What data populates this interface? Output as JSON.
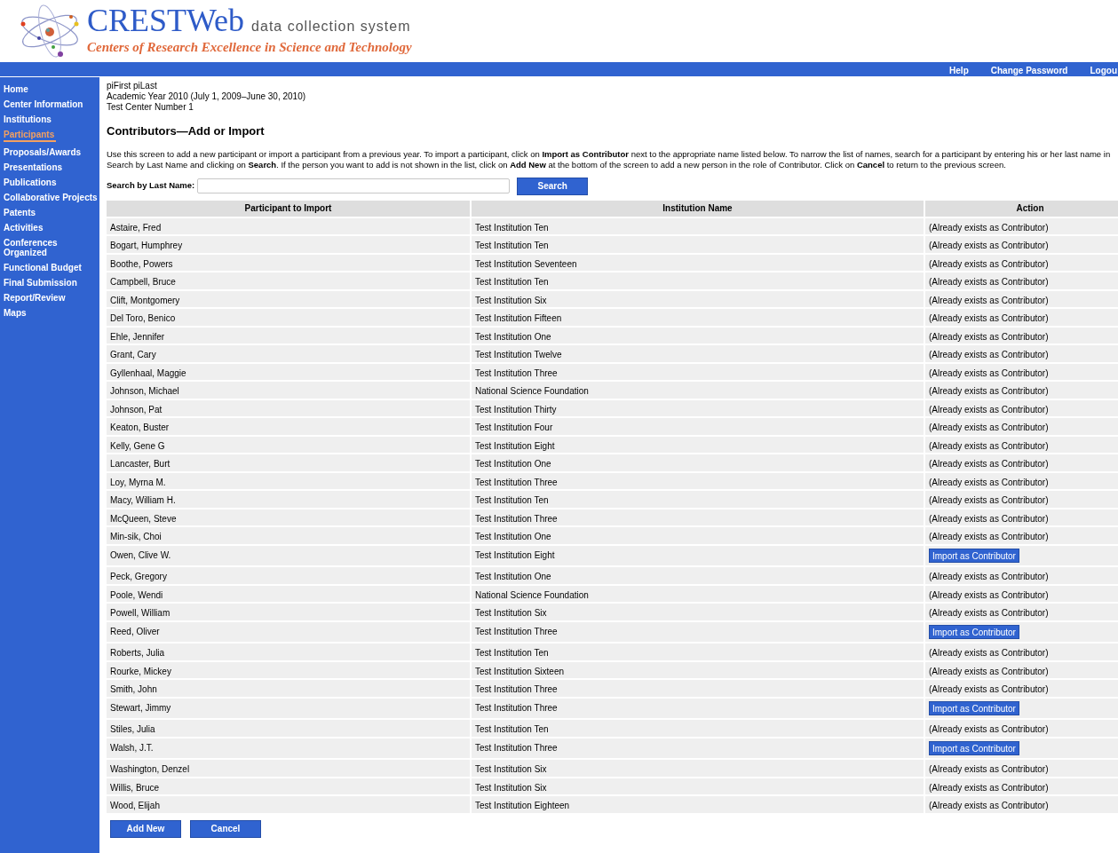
{
  "header": {
    "logo_title": "CRESTWeb",
    "logo_tagline": "data collection system",
    "logo_subtitle": "Centers of Research Excellence in Science and Technology"
  },
  "top_links": [
    "Help",
    "Change Password",
    "Logou"
  ],
  "sidebar": {
    "items": [
      {
        "label": "Home",
        "selected": false
      },
      {
        "label": "Center Information",
        "selected": false
      },
      {
        "label": "Institutions",
        "selected": false
      },
      {
        "label": "Participants",
        "selected": true
      },
      {
        "label": "Proposals/Awards",
        "selected": false
      },
      {
        "label": "Presentations",
        "selected": false
      },
      {
        "label": "Publications",
        "selected": false
      },
      {
        "label": "Collaborative Projects",
        "selected": false
      },
      {
        "label": "Patents",
        "selected": false
      },
      {
        "label": "Activities",
        "selected": false
      },
      {
        "label": "Conferences Organized",
        "selected": false
      },
      {
        "label": "Functional Budget",
        "selected": false
      },
      {
        "label": "Final Submission",
        "selected": false
      },
      {
        "label": "Report/Review",
        "selected": false
      },
      {
        "label": "Maps",
        "selected": false
      }
    ]
  },
  "context": [
    "piFirst piLast",
    "Academic Year 2010 (July 1, 2009–June 30, 2010)",
    "Test Center Number 1"
  ],
  "page_title": "Contributors—Add or Import",
  "intro": [
    "Use this screen to add a new participant or import a participant from a previous year. To import a participant, click on **Import as Contributor** next to the appropriate name listed below. To narrow the list of names, search for a participant by entering his or her last name in",
    "Search by Last Name and clicking on **Search**. If the person you want to add is not shown in the list, click on **Add New** at the bottom of the screen to add a new person in the role of Contributor. Click on **Cancel** to return to the previous screen."
  ],
  "search": {
    "label": "Search by Last Name:",
    "button": "Search"
  },
  "table": {
    "columns": [
      "Participant to Import",
      "Institution Name",
      "Action"
    ],
    "rows": [
      {
        "name": "Astaire, Fred",
        "institution": "Test Institution Ten",
        "kind": "exists",
        "action": "(Already exists as Contributor)"
      },
      {
        "name": "Bogart, Humphrey",
        "institution": "Test Institution Ten",
        "kind": "exists",
        "action": "(Already exists as Contributor)"
      },
      {
        "name": "Boothe, Powers",
        "institution": "Test Institution Seventeen",
        "kind": "exists",
        "action": "(Already exists as Contributor)"
      },
      {
        "name": "Campbell, Bruce",
        "institution": "Test Institution Ten",
        "kind": "exists",
        "action": "(Already exists as Contributor)"
      },
      {
        "name": "Clift, Montgomery",
        "institution": "Test Institution Six",
        "kind": "exists",
        "action": "(Already exists as Contributor)"
      },
      {
        "name": "Del Toro, Benico",
        "institution": "Test Institution Fifteen",
        "kind": "exists",
        "action": "(Already exists as Contributor)"
      },
      {
        "name": "Ehle, Jennifer",
        "institution": "Test Institution One",
        "kind": "exists",
        "action": "(Already exists as Contributor)"
      },
      {
        "name": "Grant, Cary",
        "institution": "Test Institution Twelve",
        "kind": "exists",
        "action": "(Already exists as Contributor)"
      },
      {
        "name": "Gyllenhaal, Maggie",
        "institution": "Test Institution Three",
        "kind": "exists",
        "action": "(Already exists as Contributor)"
      },
      {
        "name": "Johnson, Michael",
        "institution": "National Science Foundation",
        "kind": "exists",
        "action": "(Already exists as Contributor)"
      },
      {
        "name": "Johnson, Pat",
        "institution": "Test Institution Thirty",
        "kind": "exists",
        "action": "(Already exists as Contributor)"
      },
      {
        "name": "Keaton, Buster",
        "institution": "Test Institution Four",
        "kind": "exists",
        "action": "(Already exists as Contributor)"
      },
      {
        "name": "Kelly, Gene G",
        "institution": "Test Institution Eight",
        "kind": "exists",
        "action": "(Already exists as Contributor)"
      },
      {
        "name": "Lancaster, Burt",
        "institution": "Test Institution One",
        "kind": "exists",
        "action": "(Already exists as Contributor)"
      },
      {
        "name": "Loy, Myrna M.",
        "institution": "Test Institution Three",
        "kind": "exists",
        "action": "(Already exists as Contributor)"
      },
      {
        "name": "Macy, William H.",
        "institution": "Test Institution Ten",
        "kind": "exists",
        "action": "(Already exists as Contributor)"
      },
      {
        "name": "McQueen, Steve",
        "institution": "Test Institution Three",
        "kind": "exists",
        "action": "(Already exists as Contributor)"
      },
      {
        "name": "Min-sik, Choi",
        "institution": "Test Institution One",
        "kind": "exists",
        "action": "(Already exists as Contributor)"
      },
      {
        "name": "Owen, Clive W.",
        "institution": "Test Institution Eight",
        "kind": "import",
        "action": "Import as Contributor"
      },
      {
        "name": "Peck, Gregory",
        "institution": "Test Institution One",
        "kind": "exists",
        "action": "(Already exists as Contributor)"
      },
      {
        "name": "Poole, Wendi",
        "institution": "National Science Foundation",
        "kind": "exists",
        "action": "(Already exists as Contributor)"
      },
      {
        "name": "Powell, William",
        "institution": "Test Institution Six",
        "kind": "exists",
        "action": "(Already exists as Contributor)"
      },
      {
        "name": "Reed, Oliver",
        "institution": "Test Institution Three",
        "kind": "import",
        "action": "Import as Contributor"
      },
      {
        "name": "Roberts, Julia",
        "institution": "Test Institution Ten",
        "kind": "exists",
        "action": "(Already exists as Contributor)"
      },
      {
        "name": "Rourke, Mickey",
        "institution": "Test Institution Sixteen",
        "kind": "exists",
        "action": "(Already exists as Contributor)"
      },
      {
        "name": "Smith, John",
        "institution": "Test Institution Three",
        "kind": "exists",
        "action": "(Already exists as Contributor)"
      },
      {
        "name": "Stewart, Jimmy",
        "institution": "Test Institution Three",
        "kind": "import",
        "action": "Import as Contributor"
      },
      {
        "name": "Stiles, Julia",
        "institution": "Test Institution Ten",
        "kind": "exists",
        "action": "(Already exists as Contributor)"
      },
      {
        "name": "Walsh, J.T.",
        "institution": "Test Institution Three",
        "kind": "import",
        "action": "Import as Contributor"
      },
      {
        "name": "Washington, Denzel",
        "institution": "Test Institution Six",
        "kind": "exists",
        "action": "(Already exists as Contributor)"
      },
      {
        "name": "Willis, Bruce",
        "institution": "Test Institution Six",
        "kind": "exists",
        "action": "(Already exists as Contributor)"
      },
      {
        "name": "Wood, Elijah",
        "institution": "Test Institution Eighteen",
        "kind": "exists",
        "action": "(Already exists as Contributor)"
      }
    ]
  },
  "buttons": [
    "Add New",
    "Cancel"
  ]
}
